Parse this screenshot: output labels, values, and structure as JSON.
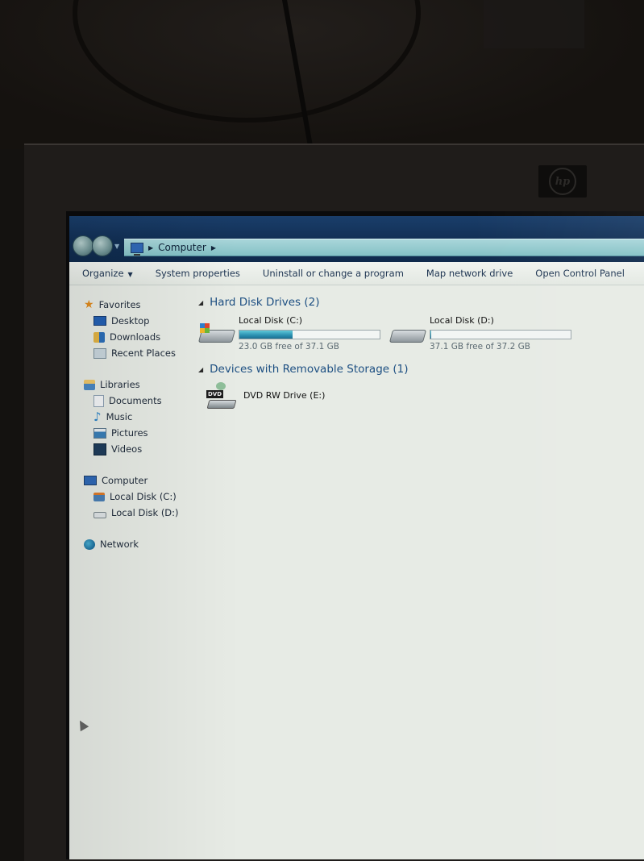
{
  "window": {
    "breadcrumb": [
      "Computer"
    ],
    "nav": {
      "back_icon": "back-arrow-icon",
      "forward_icon": "forward-arrow-icon",
      "recent_icon": "chevron-down-icon"
    }
  },
  "toolbar": {
    "items": [
      {
        "label": "Organize",
        "has_dropdown": true
      },
      {
        "label": "System properties"
      },
      {
        "label": "Uninstall or change a program"
      },
      {
        "label": "Map network drive"
      },
      {
        "label": "Open Control Panel"
      }
    ]
  },
  "sidebar": {
    "groups": [
      {
        "label": "Favorites",
        "icon": "star-icon",
        "items": [
          {
            "label": "Desktop",
            "icon": "desktop-icon"
          },
          {
            "label": "Downloads",
            "icon": "downloads-icon"
          },
          {
            "label": "Recent Places",
            "icon": "recent-places-icon"
          }
        ]
      },
      {
        "label": "Libraries",
        "icon": "libraries-icon",
        "items": [
          {
            "label": "Documents",
            "icon": "documents-icon"
          },
          {
            "label": "Music",
            "icon": "music-icon"
          },
          {
            "label": "Pictures",
            "icon": "pictures-icon"
          },
          {
            "label": "Videos",
            "icon": "videos-icon"
          }
        ]
      },
      {
        "label": "Computer",
        "icon": "computer-icon",
        "items": [
          {
            "label": "Local Disk (C:)",
            "icon": "local-disk-c-icon"
          },
          {
            "label": "Local Disk (D:)",
            "icon": "local-disk-d-icon"
          }
        ]
      },
      {
        "label": "Network",
        "icon": "network-icon",
        "items": []
      }
    ]
  },
  "main": {
    "hard_disk_section": {
      "title": "Hard Disk Drives (2)",
      "drives": [
        {
          "name": "Local Disk (C:)",
          "free_text": "23.0 GB free of 37.1 GB",
          "used_fraction": 0.38,
          "icon": "windows-hard-disk-icon"
        },
        {
          "name": "Local Disk (D:)",
          "free_text": "37.1 GB free of 37.2 GB",
          "used_fraction": 0.003,
          "icon": "hard-disk-icon"
        }
      ]
    },
    "removable_section": {
      "title": "Devices with Removable Storage (1)",
      "devices": [
        {
          "name": "DVD RW Drive (E:)",
          "icon": "dvd-drive-icon",
          "badge": "DVD"
        }
      ]
    }
  },
  "monitor": {
    "brand": "hp"
  }
}
